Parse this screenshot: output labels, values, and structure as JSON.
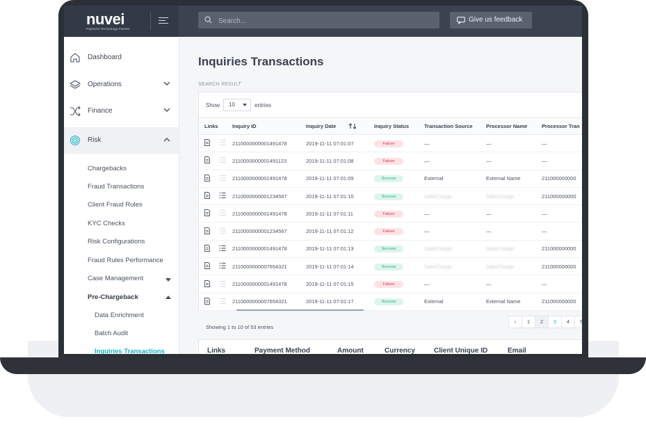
{
  "brand": {
    "logo": "nuvei",
    "tagline": "Payment Technology Partner"
  },
  "topbar": {
    "search_placeholder": "Search...",
    "feedback_label": "Give us feedback"
  },
  "sidebar": {
    "items": [
      {
        "label": "Dashboard",
        "icon": "home-icon"
      },
      {
        "label": "Operations",
        "icon": "layers-icon"
      },
      {
        "label": "Finance",
        "icon": "shuffle-icon"
      },
      {
        "label": "Risk",
        "icon": "fingerprint-icon"
      }
    ],
    "risk_sub": [
      "Chargebacks",
      "Fraud Transactions",
      "Client Fraud Rules",
      "KYC Checks",
      "Risk Configurations",
      "Fraud Rules Performance",
      "Case Management",
      "Pre-Chargeback"
    ],
    "prechargeback_sub": [
      "Data Enrichment",
      "Batch Audit",
      "Inquiries Transactions"
    ]
  },
  "main": {
    "title": "Inquiries Transactions",
    "section_label": "SEARCH RESULT",
    "show_label": "Show",
    "page_size": "10",
    "entries_label": "entries",
    "columns": [
      "Links",
      "Inquiry ID",
      "Inquiry Date",
      "Inquiry Status",
      "Transaction Source",
      "Processor Name",
      "Processor Tran"
    ],
    "rows": [
      {
        "id": "2110000000001491478",
        "date": "2019-11-11 07:01:07",
        "status": "Failure",
        "source": "—",
        "processor": "—",
        "ptid": "—",
        "list": false
      },
      {
        "id": "2110000000001491123",
        "date": "2019-11-11 07:01:08",
        "status": "Failure",
        "source": "—",
        "processor": "—",
        "ptid": "—",
        "list": false
      },
      {
        "id": "2110000000001491478",
        "date": "2019-11-11 07:01:09",
        "status": "Success",
        "source": "External",
        "processor": "External Name",
        "ptid": "211000000000",
        "list": false
      },
      {
        "id": "2110000000001234567",
        "date": "2019-11-11 07:01:10",
        "status": "Success",
        "source": "SafeCharge",
        "processor": "SafeCharge",
        "ptid": "211000000000",
        "list": true
      },
      {
        "id": "2110000000001491478",
        "date": "2019-11-11 07:01:11",
        "status": "Failure",
        "source": "—",
        "processor": "—",
        "ptid": "—",
        "list": false
      },
      {
        "id": "2110000000001234567",
        "date": "2019-11-11 07:01:12",
        "status": "Failure",
        "source": "—",
        "processor": "—",
        "ptid": "—",
        "list": false
      },
      {
        "id": "2110000000001491478",
        "date": "2019-11-11 07:01:13",
        "status": "Success",
        "source": "SafeCharge",
        "processor": "SafeCharge",
        "ptid": "211000000000",
        "list": true
      },
      {
        "id": "2110000000007654321",
        "date": "2019-11-11 07:01:14",
        "status": "Success",
        "source": "SafeCharge",
        "processor": "SafeCharge",
        "ptid": "211000000000",
        "list": true
      },
      {
        "id": "2110000000001491478",
        "date": "2019-11-11 07:01:15",
        "status": "Failure",
        "source": "—",
        "processor": "—",
        "ptid": "—",
        "list": false
      },
      {
        "id": "2110000000007654321",
        "date": "2019-11-11 07:01:17",
        "status": "Success",
        "source": "External",
        "processor": "External Name",
        "ptid": "211000000000",
        "list": false
      }
    ],
    "footer": "Showing 1 to 10 of 53 entries",
    "pages": [
      "‹",
      "1",
      "2",
      "3",
      "4",
      "5"
    ],
    "second_table_columns": [
      "Links",
      "Payment Method",
      "Amount",
      "Currency",
      "Client Unique ID",
      "Email"
    ]
  },
  "colors": {
    "accent": "#19b3c2",
    "topbar": "#3b4250",
    "failure": "#d3384d",
    "success": "#2fa57a"
  }
}
